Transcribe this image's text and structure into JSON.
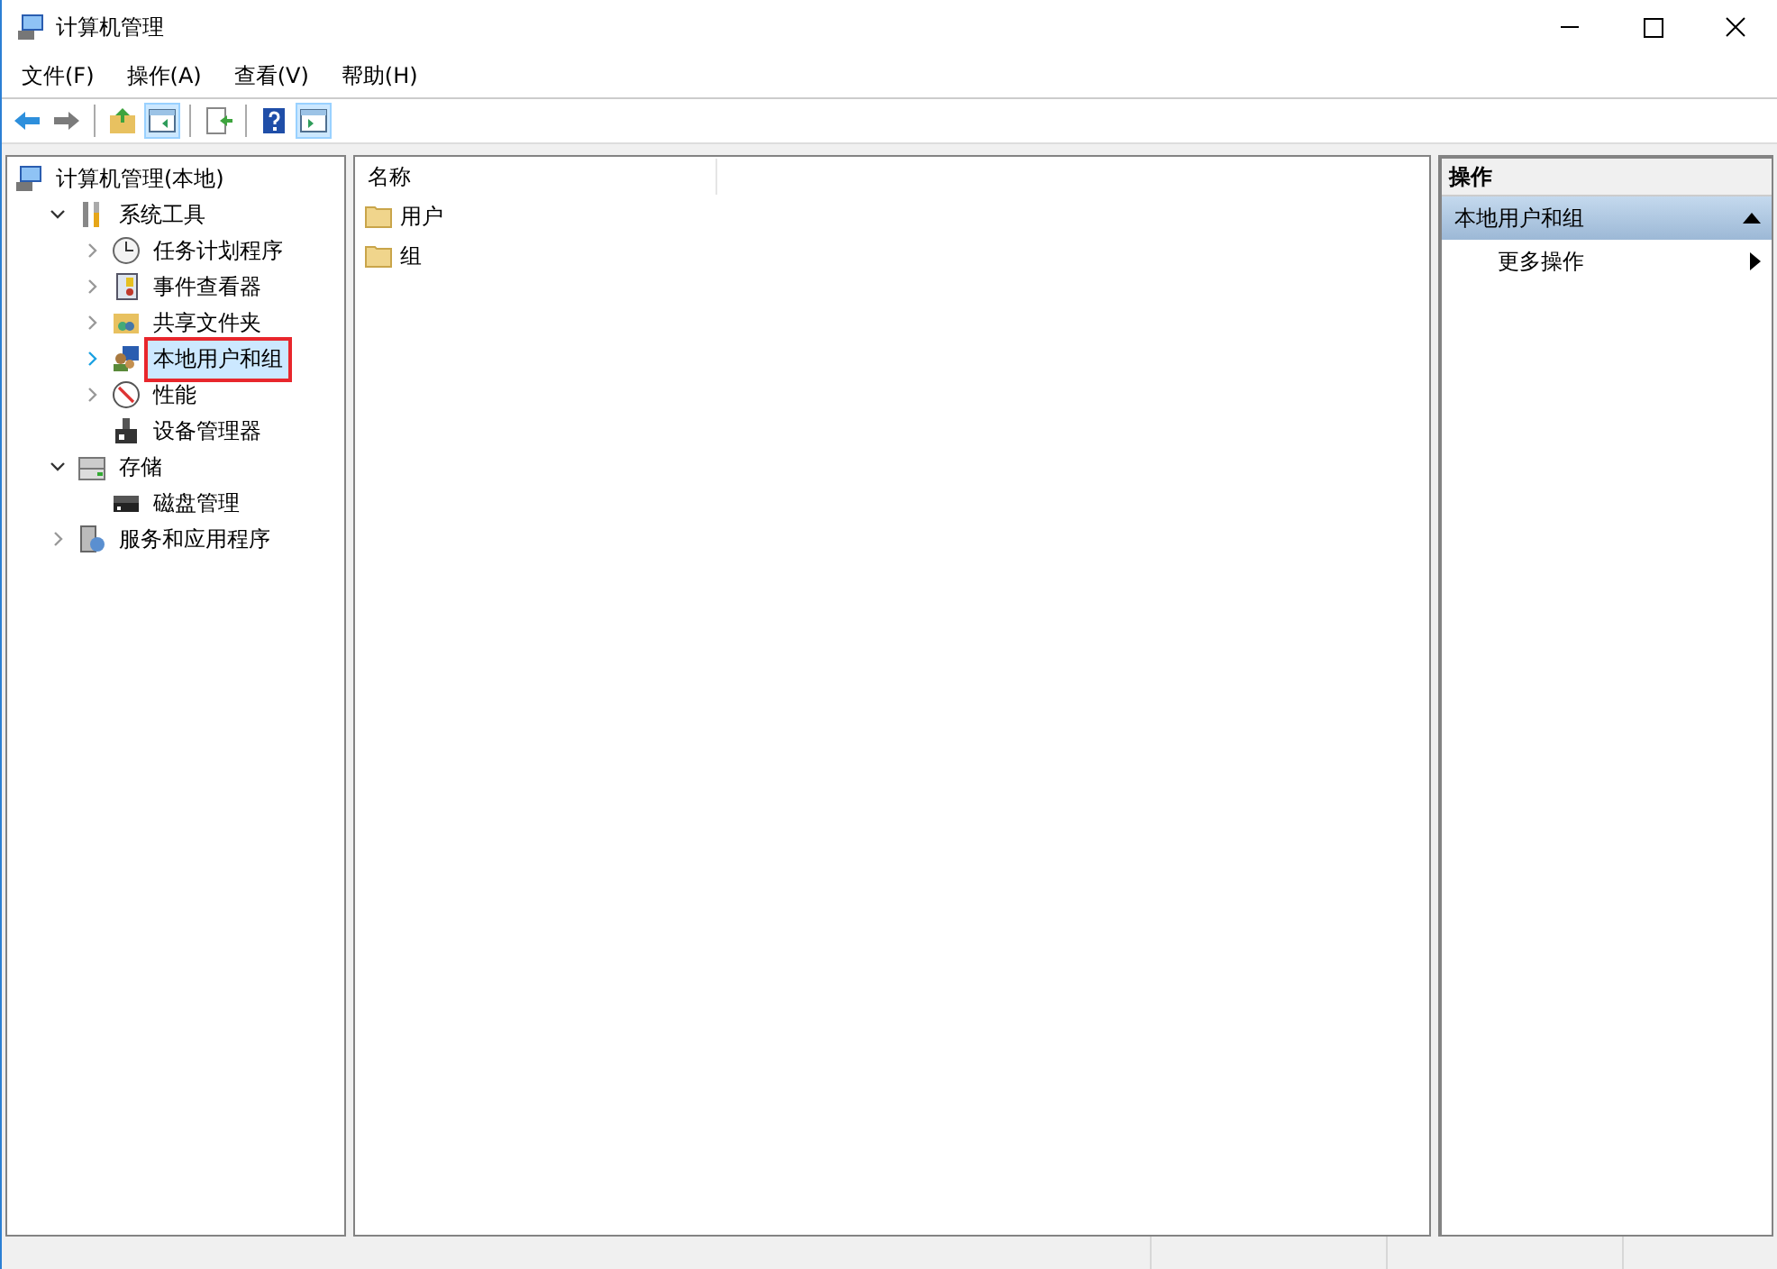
{
  "window": {
    "title": "计算机管理"
  },
  "menu": [
    "文件(F)",
    "操作(A)",
    "查看(V)",
    "帮助(H)"
  ],
  "toolbar": [
    {
      "kind": "back",
      "pressed": false
    },
    {
      "kind": "forward",
      "pressed": false
    },
    {
      "kind": "sep"
    },
    {
      "kind": "up",
      "pressed": false
    },
    {
      "kind": "tree",
      "pressed": true
    },
    {
      "kind": "sep"
    },
    {
      "kind": "export",
      "pressed": false
    },
    {
      "kind": "sep"
    },
    {
      "kind": "help",
      "pressed": false
    },
    {
      "kind": "pane",
      "pressed": true
    }
  ],
  "tree": [
    {
      "label": "计算机管理(本地)",
      "kind": "computer",
      "selected": false,
      "marked": false,
      "children": [
        {
          "label": "系统工具",
          "kind": "tools",
          "expanded": true,
          "selected": false,
          "marked": false,
          "children": [
            {
              "label": "任务计划程序",
              "kind": "clock",
              "expanded": false,
              "selected": false,
              "marked": false
            },
            {
              "label": "事件查看器",
              "kind": "log",
              "expanded": false,
              "selected": false,
              "marked": false
            },
            {
              "label": "共享文件夹",
              "kind": "share",
              "expanded": false,
              "selected": false,
              "marked": false
            },
            {
              "label": "本地用户和组",
              "kind": "users",
              "expanded": false,
              "selected": true,
              "marked": true
            },
            {
              "label": "性能",
              "kind": "gauge",
              "expanded": false,
              "selected": false,
              "marked": false
            },
            {
              "label": "设备管理器",
              "kind": "device",
              "selected": false,
              "marked": false
            }
          ]
        },
        {
          "label": "存储",
          "kind": "storage",
          "expanded": true,
          "selected": false,
          "marked": false,
          "children": [
            {
              "label": "磁盘管理",
              "kind": "disk",
              "selected": false,
              "marked": false
            }
          ]
        },
        {
          "label": "服务和应用程序",
          "kind": "services",
          "expanded": false,
          "selected": false,
          "marked": false
        }
      ]
    }
  ],
  "list": {
    "columns": [
      "名称"
    ],
    "rows": [
      {
        "name": "用户"
      },
      {
        "name": "组"
      }
    ]
  },
  "actions": {
    "title": "操作",
    "section": {
      "label": "本地用户和组",
      "expanded": true
    },
    "items": [
      {
        "label": "更多操作"
      }
    ]
  }
}
